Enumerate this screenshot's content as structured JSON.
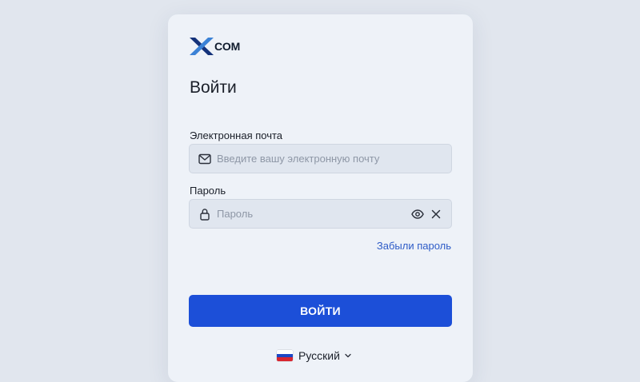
{
  "brand": {
    "logo_text": "COM",
    "logo_colors": {
      "dark": "#14327a",
      "light": "#3b82d6"
    }
  },
  "login": {
    "title": "Войти",
    "email": {
      "label": "Электронная почта",
      "placeholder": "Введите вашу электронную почту",
      "value": "",
      "icon": "mail-icon"
    },
    "password": {
      "label": "Пароль",
      "placeholder": "Пароль",
      "value": "",
      "icon": "lock-icon",
      "actions": [
        "eye-icon",
        "clear-icon"
      ]
    },
    "forgot_link": "Забыли пароль",
    "submit_label": "ВОЙТИ"
  },
  "language": {
    "selected": "Русский",
    "flag": {
      "colors": [
        "#ffffff",
        "#1c47c4",
        "#d8262f"
      ]
    }
  },
  "colors": {
    "background": "#e1e6ee",
    "card": "#eef2f8",
    "accent": "#1c4fd8",
    "link": "#2d5bc7"
  }
}
